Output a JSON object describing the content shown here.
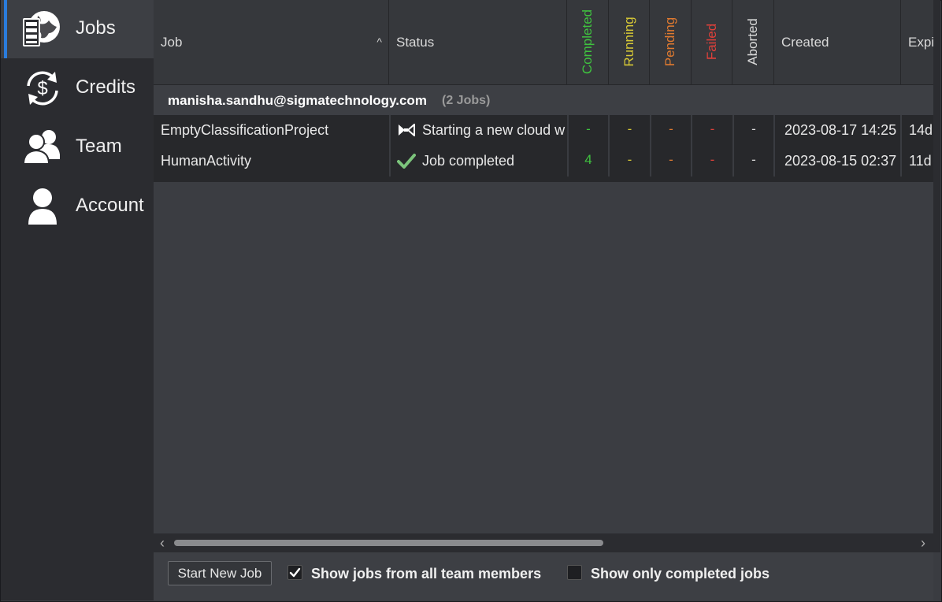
{
  "sidebar": {
    "items": [
      {
        "label": "Jobs",
        "icon": "server-globe-icon",
        "active": true
      },
      {
        "label": "Credits",
        "icon": "dollar-cycle-icon",
        "active": false
      },
      {
        "label": "Team",
        "icon": "team-icon",
        "active": false
      },
      {
        "label": "Account",
        "icon": "user-icon",
        "active": false
      }
    ]
  },
  "table": {
    "columns": {
      "job": "Job",
      "status": "Status",
      "completed": "Completed",
      "running": "Running",
      "pending": "Pending",
      "failed": "Failed",
      "aborted": "Aborted",
      "created": "Created",
      "expires": "Expi"
    },
    "sort_indicator": "^",
    "group": {
      "email": "manisha.sandhu@sigmatechnology.com",
      "count": "(2 Jobs)"
    },
    "rows": [
      {
        "job": "EmptyClassificationProject",
        "status_icon": "bowtie-icon",
        "status": "Starting a new cloud w",
        "completed": "-",
        "running": "-",
        "pending": "-",
        "failed": "-",
        "aborted": "-",
        "created": "2023-08-17 14:25",
        "expires": "14d"
      },
      {
        "job": "HumanActivity",
        "status_icon": "checkmark-icon",
        "status": "Job completed",
        "completed": "4",
        "running": "-",
        "pending": "-",
        "failed": "-",
        "aborted": "-",
        "created": "2023-08-15 02:37",
        "expires": "11d"
      }
    ]
  },
  "footer": {
    "start_button": "Start New Job",
    "show_all_label": "Show jobs from all team members",
    "show_all_checked": true,
    "show_completed_label": "Show only completed jobs",
    "show_completed_checked": false
  },
  "colors": {
    "completed": "#3fc23f",
    "running": "#d6c836",
    "pending": "#e07a30",
    "failed": "#e0403a",
    "aborted": "#d9d9d9",
    "accent": "#2a7cdc"
  }
}
